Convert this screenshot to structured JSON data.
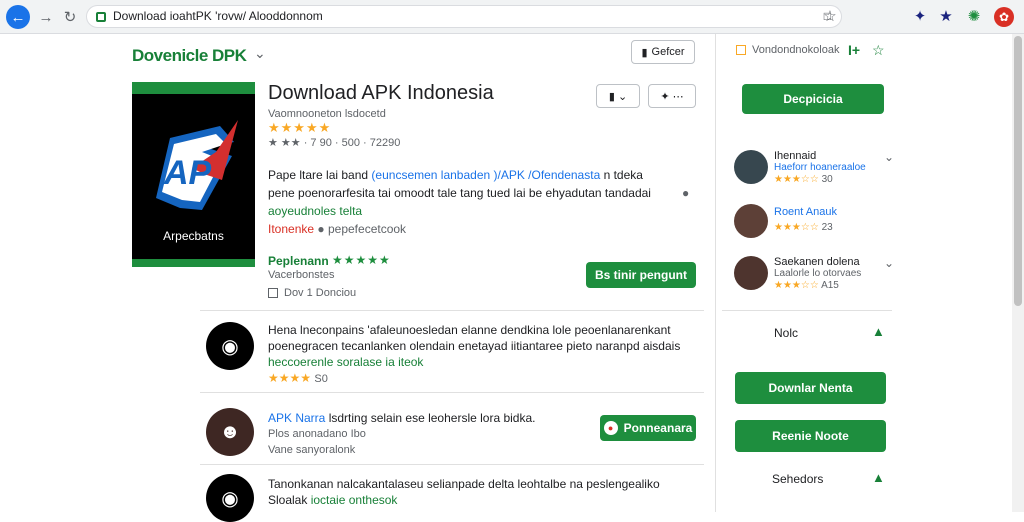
{
  "browser": {
    "url": "Download ioahtPK 'rovw/ Alooddonnom",
    "back_icon": "arrow-left-icon",
    "forward_icon": "arrow-right-icon",
    "reload_icon": "reload-icon",
    "bookmark_icon": "star-icon"
  },
  "header": {
    "brand": "Dovenicle DPK",
    "button_label": "Gefcer"
  },
  "app": {
    "title": "Download APK Indonesia",
    "subtitle": "Vaomnooneton lsdocetd",
    "rating_stars": "★★★★★",
    "meta": "★ ★★ · 7 90 · 500 · 72290",
    "hero_caption": "Arpecbatns",
    "description_line1": "Pape ltare lai band",
    "description_hl": "(euncsemen lanbaden )/APK /Ofendenasta",
    "description_line1_end": "n tdeka",
    "description_line2": "pene poenorarfesita tai omoodt tale tang tued lai be ehyadutan tandadai",
    "description_link": "aoyeudnoles telta",
    "description_tag": "Itonenke",
    "description_tag2": "pepefecetcook",
    "related_label": "Peplenann",
    "related_stars": "★★★★★",
    "related_sub": "Vacerbonstes",
    "checkbox_label": "Dov 1 Donciou",
    "action_button": "Bs tinir pengunt"
  },
  "list": [
    {
      "line1": "Hena lneconpains 'afaleunoesledan elanne dendkina lole peoenlanarenkant",
      "line2": "poenegracen tecanlanken olendain enetayad iitiantaree pieto naranpd aisdais",
      "link": "heccoerenle soralase ia iteok",
      "stars": "★★★★",
      "count": "S0"
    },
    {
      "title": "APK Narra",
      "line1": "lsdrting selain ese leohersle lora bidka.",
      "line2": "Plos anonadano Ibo",
      "line3": "Vane sanyoralonk",
      "button": "Ponneanara"
    },
    {
      "line1": "Tanonkanan nalcakantalaseu selianpade delta leohtalbe na peslengealiko",
      "line2": "Sloalak",
      "link": "ioctaie onthesok"
    }
  ],
  "sidebar": {
    "tab_label": "Vondondnokoloak",
    "tab_extra": "I+",
    "primary_button": "Decpicicia",
    "people": [
      {
        "name": "Ihennaid",
        "sub": "Haeforr hoaneraaloe",
        "stars": "★★★☆☆",
        "count": "30"
      },
      {
        "name": "Roent Anauk",
        "sub": "",
        "stars": "★★★☆☆",
        "count": "23"
      },
      {
        "name": "Saekanen dolena",
        "sub": "Laalorle lo otorvaes",
        "stars": "★★★☆☆",
        "count": "A15"
      }
    ],
    "label_1": "Nolc",
    "button_1": "Downlar Nenta",
    "button_2": "Reenie Noote",
    "label_2": "Sehedors"
  },
  "colors": {
    "accent_green": "#1e8e3e",
    "link_blue": "#1a73e8",
    "star_gold": "#f9a825"
  }
}
